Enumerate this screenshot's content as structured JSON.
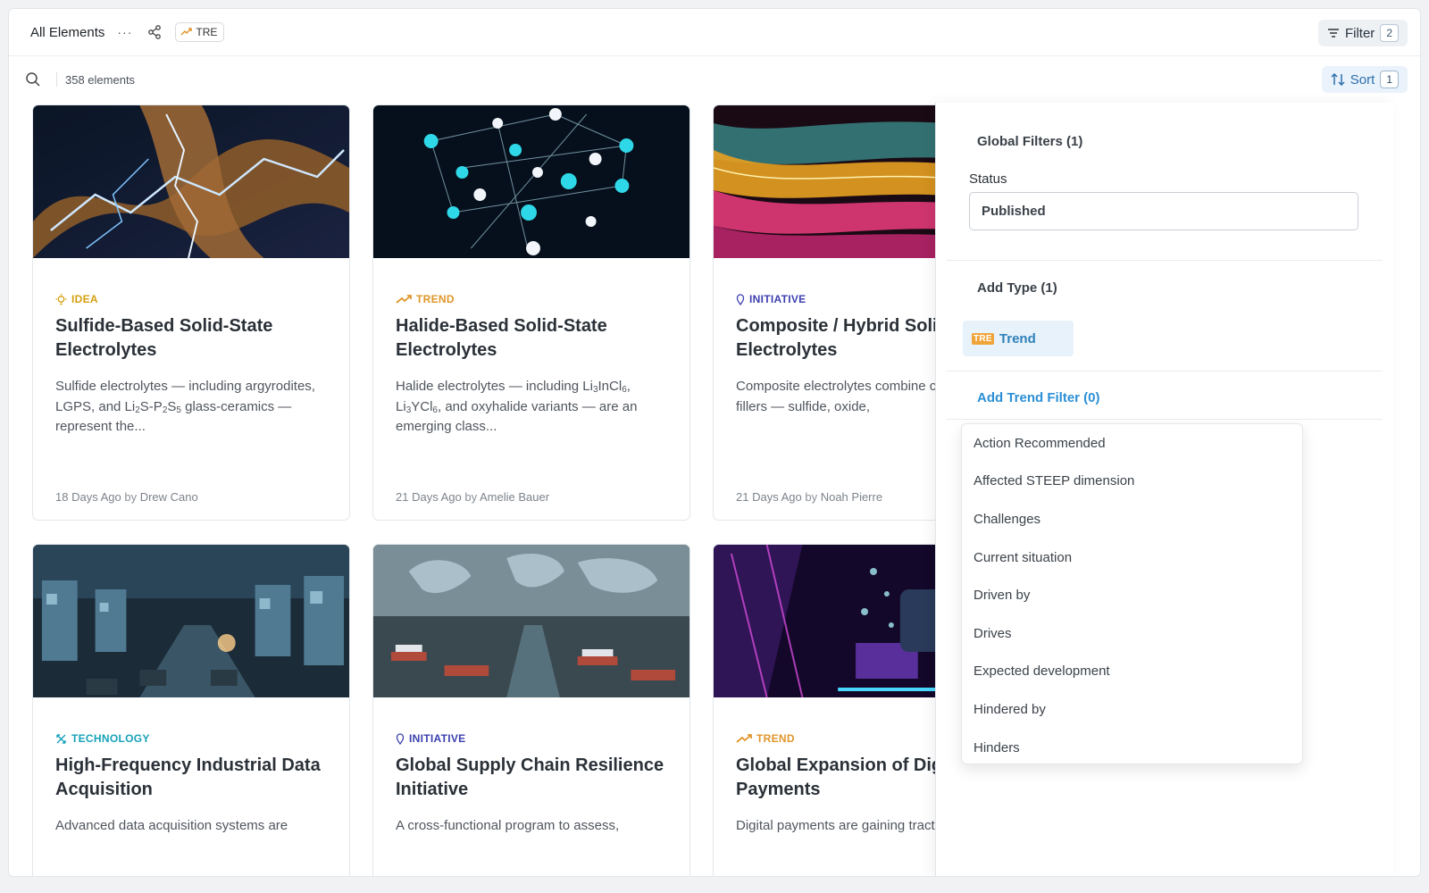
{
  "header": {
    "title": "All Elements",
    "more_label": "···",
    "tre_chip": "TRE",
    "filter_label": "Filter",
    "filter_count": "2"
  },
  "toolbar": {
    "element_count": "358 elements",
    "sort_label": "Sort",
    "sort_count": "1"
  },
  "cards": [
    {
      "tag": "IDEA",
      "tag_color": "#d4a00f",
      "tag_icon": "lightbulb-icon",
      "title": "Sulfide-Based Solid-State Electrolytes",
      "desc_parts": [
        "Sulfide electrolytes — including argyrodites, LGPS, and Li",
        "2",
        "S-P",
        "2",
        "S",
        "5",
        " glass-ceramics — represent the..."
      ],
      "age": "18 Days Ago",
      "by": "by",
      "author": "Drew Cano",
      "image": "electric-network-image"
    },
    {
      "tag": "TREND",
      "tag_color": "#e0962a",
      "tag_icon": "trend-arrow-icon",
      "title": "Halide-Based Solid-State Electrolytes",
      "desc_parts": [
        "Halide electrolytes — including Li",
        "3",
        "InCl",
        "6",
        ", Li",
        "3",
        "YCl",
        "6",
        ", and oxyhalide variants — are an emerging class..."
      ],
      "age": "21 Days Ago",
      "by": "by",
      "author": "Amelie Bauer",
      "image": "crystal-lattice-image"
    },
    {
      "tag": "INITIATIVE",
      "tag_color": "#3b3fb0",
      "tag_icon": "pin-icon",
      "title": "Composite / Hybrid Solid Electrolytes",
      "desc": "Composite electrolytes combine ceramic fillers — sulfide, oxide,",
      "age": "21 Days Ago",
      "by": "by",
      "author": "Noah Pierre",
      "image": "colorful-waves-image"
    },
    {
      "tag": "TECHNOLOGY",
      "tag_color": "#17a2b8",
      "tag_icon": "technology-icon",
      "title": "High-Frequency Industrial Data Acquisition",
      "desc": "Advanced data acquisition systems are",
      "image": "industrial-plant-image"
    },
    {
      "tag": "INITIATIVE",
      "tag_color": "#3b3fb0",
      "tag_icon": "pin-icon",
      "title": "Global Supply Chain Resilience Initiative",
      "desc": "A cross-functional program to assess,",
      "image": "world-port-image"
    },
    {
      "tag": "TREND",
      "tag_color": "#e0962a",
      "tag_icon": "trend-arrow-icon",
      "title": "Global Expansion of Digital Payments",
      "desc": "Digital payments are gaining traction",
      "image": "digital-payment-image"
    }
  ],
  "panel": {
    "global_filters": "Global Filters (1)",
    "status_label": "Status",
    "status_value": "Published",
    "add_type": "Add Type (1)",
    "type_badge": "TRE",
    "type_label": "Trend",
    "add_trend_filter": "Add Trend Filter (0)",
    "options": [
      "Action Recommended",
      "Affected STEEP dimension",
      "Challenges",
      "Current situation",
      "Driven by",
      "Drives",
      "Expected development",
      "Hindered by",
      "Hinders"
    ]
  }
}
